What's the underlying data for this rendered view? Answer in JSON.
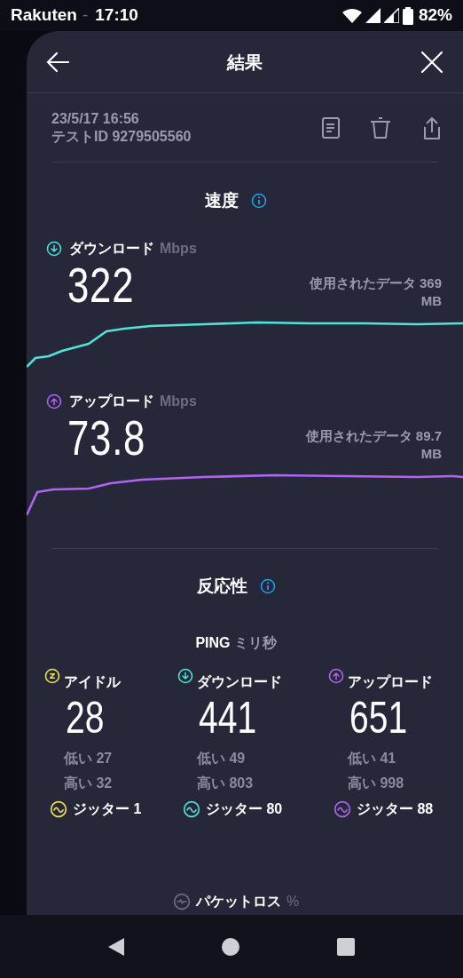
{
  "status_bar": {
    "carrier": "Rakuten",
    "separator": "-",
    "time": "17:10",
    "battery": "82%"
  },
  "header": {
    "title": "結果"
  },
  "meta": {
    "date": "23/5/17 16:56",
    "test_id": "テストID 9279505560"
  },
  "speed": {
    "heading": "速度",
    "items": [
      {
        "kind": "download",
        "label": "ダウンロード",
        "unit": "Mbps",
        "value": "322",
        "data_used": "使用されたデータ 369",
        "data_unit": "MB",
        "color": "#4fe3d9"
      },
      {
        "kind": "upload",
        "label": "アップロード",
        "unit": "Mbps",
        "value": "73.8",
        "data_used": "使用されたデータ 89.7",
        "data_unit": "MB",
        "color": "#b065f0"
      }
    ]
  },
  "responsiveness": {
    "heading": "反応性",
    "ping_label": "PING",
    "ping_unit": "ミリ秒",
    "columns": [
      {
        "kind": "idle",
        "label": "アイドル",
        "value": "28",
        "low": "低い 27",
        "high": "高い 32",
        "jitter": "ジッター 1",
        "color": "#f2e15a"
      },
      {
        "kind": "download",
        "label": "ダウンロード",
        "value": "441",
        "low": "低い 49",
        "high": "高い 803",
        "jitter": "ジッター 80",
        "color": "#4fe3d9"
      },
      {
        "kind": "upload",
        "label": "アップロード",
        "value": "651",
        "low": "低い 41",
        "high": "高い 998",
        "jitter": "ジッター 88",
        "color": "#b065f0"
      }
    ]
  },
  "packet_loss": {
    "label": "パケットロス",
    "unit": "%"
  }
}
